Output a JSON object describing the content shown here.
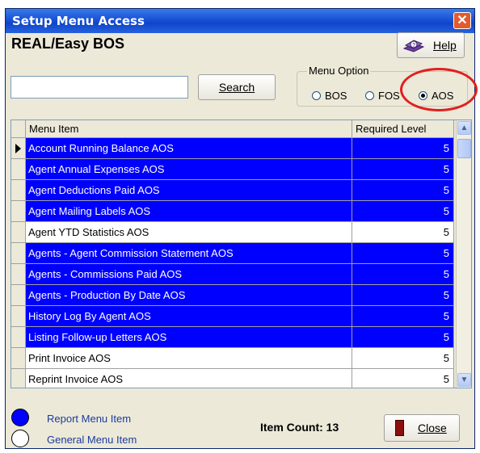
{
  "window": {
    "title": "Setup Menu Access",
    "close_glyph": "✕"
  },
  "header": {
    "app_title": "REAL/Easy BOS",
    "help_label": "Help",
    "help_icon": "help-book-icon"
  },
  "search": {
    "value": "",
    "button_label": "Search"
  },
  "menu_option": {
    "legend": "Menu Option",
    "options": [
      {
        "label": "BOS",
        "selected": false
      },
      {
        "label": "FOS",
        "selected": false
      },
      {
        "label": "AOS",
        "selected": true
      }
    ]
  },
  "grid": {
    "columns": [
      "Menu Item",
      "Required Level"
    ],
    "rows": [
      {
        "name": "Account Running Balance AOS",
        "level": "5",
        "type": "report",
        "current": true
      },
      {
        "name": "Agent Annual Expenses AOS",
        "level": "5",
        "type": "report"
      },
      {
        "name": "Agent Deductions Paid AOS",
        "level": "5",
        "type": "report"
      },
      {
        "name": "Agent Mailing Labels AOS",
        "level": "5",
        "type": "report"
      },
      {
        "name": "Agent YTD Statistics AOS",
        "level": "5",
        "type": "general"
      },
      {
        "name": "Agents - Agent Commission Statement AOS",
        "level": "5",
        "type": "report"
      },
      {
        "name": "Agents - Commissions Paid AOS",
        "level": "5",
        "type": "report"
      },
      {
        "name": "Agents - Production By Date AOS",
        "level": "5",
        "type": "report"
      },
      {
        "name": "History Log By Agent AOS",
        "level": "5",
        "type": "report"
      },
      {
        "name": "Listing Follow-up Letters AOS",
        "level": "5",
        "type": "report"
      },
      {
        "name": "Print Invoice AOS",
        "level": "5",
        "type": "general"
      },
      {
        "name": "Reprint Invoice AOS",
        "level": "5",
        "type": "general"
      }
    ]
  },
  "legend_items": [
    {
      "label": "Report Menu Item",
      "color": "#0000ff"
    },
    {
      "label": "General Menu Item",
      "color": "#ffffff"
    }
  ],
  "footer": {
    "item_count": "Item Count: 13",
    "close_label": "Close"
  },
  "colors": {
    "report_row": "#0000ff",
    "highlight_ring": "#e02020",
    "titlebar": "#1c55d8"
  }
}
